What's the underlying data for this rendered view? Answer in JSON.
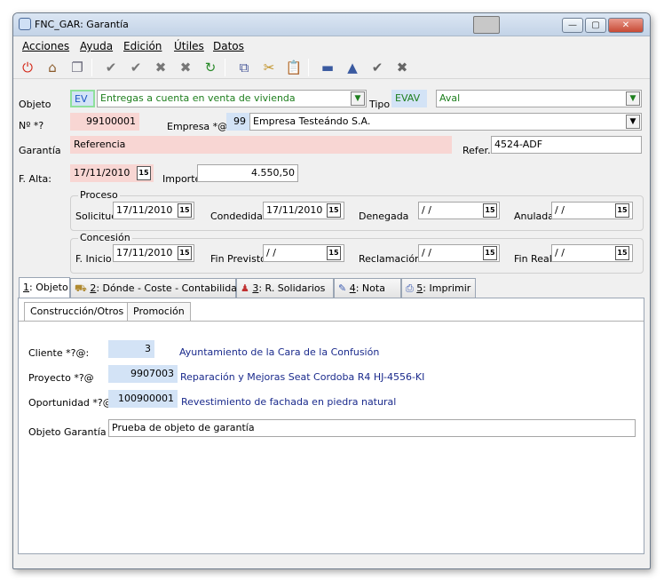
{
  "window": {
    "title": "FNC_GAR: Garantía"
  },
  "menu": [
    "Acciones",
    "Ayuda",
    "Edición",
    "Útiles",
    "Datos"
  ],
  "toolbar_icons": [
    "power-icon",
    "home-icon",
    "windows-icon",
    "check-all-icon",
    "check-new-icon",
    "delete-icon",
    "delete-all-icon",
    "refresh-icon",
    "copy-icon",
    "cut-icon",
    "paste-icon",
    "minus-icon",
    "up-icon",
    "tick-icon",
    "cross-icon"
  ],
  "form": {
    "objeto_label": "Objeto",
    "objeto_code": "EV",
    "objeto_value": "Entregas a cuenta en venta de vivienda",
    "tipo_label": "Tipo",
    "tipo_code": "EVAV",
    "tipo_value": "Aval",
    "num_label": "Nº *?",
    "num_value": "99100001",
    "empresa_label": "Empresa *@:",
    "empresa_code": "99",
    "empresa_value": "Empresa Testeándo S.A.",
    "garantia_label": "Garantía",
    "garantia_value": "Referencia",
    "refer_label": "Refer.",
    "refer_value": "4524-ADF",
    "alta_label": "F. Alta:",
    "alta_value": "17/11/2010",
    "importe_label": "Importe",
    "importe_value": "4.550,50"
  },
  "proceso": {
    "title": "Proceso",
    "solicitud_label": "Solicitud",
    "solicitud_value": "17/11/2010",
    "concedida_label": "Condedida",
    "concedida_value": "17/11/2010",
    "denegada_label": "Denegada",
    "denegada_value": " / /",
    "anulada_label": "Anulada",
    "anulada_value": " / /"
  },
  "concesion": {
    "title": "Concesión",
    "inicio_label": "F. Inicio",
    "inicio_value": "17/11/2010",
    "finprev_label": "Fin Previsto",
    "finprev_value": " / /",
    "reclamacion_label": "Reclamación",
    "reclamacion_value": " / /",
    "finreal_label": "Fin Real",
    "finreal_value": " / /"
  },
  "cal_glyph": "15",
  "tabs": [
    {
      "num": "1",
      "label": ": Objeto"
    },
    {
      "num": "2",
      "label": ": Dónde - Coste - Contabilidad"
    },
    {
      "num": "3",
      "label": ": R. Solidarios"
    },
    {
      "num": "4",
      "label": ": Nota"
    },
    {
      "num": "5",
      "label": ": Imprimir"
    }
  ],
  "subtabs": [
    "Construcción/Otros",
    "Promoción"
  ],
  "detail": {
    "cliente_label": "Cliente *?@:",
    "cliente_code": "3",
    "cliente_value": "Ayuntamiento de la Cara de la Confusión",
    "proyecto_label": "Proyecto *?@",
    "proyecto_code": "9907003",
    "proyecto_value": "Reparación y Mejoras Seat Cordoba R4 HJ-4556-KI",
    "oportunidad_label": "Oportunidad *?@",
    "oportunidad_code": "100900001",
    "oportunidad_value": "Revestimiento de fachada en piedra natural",
    "objgar_label": "Objeto Garantía",
    "objgar_value": "Prueba de objeto de garantía"
  }
}
